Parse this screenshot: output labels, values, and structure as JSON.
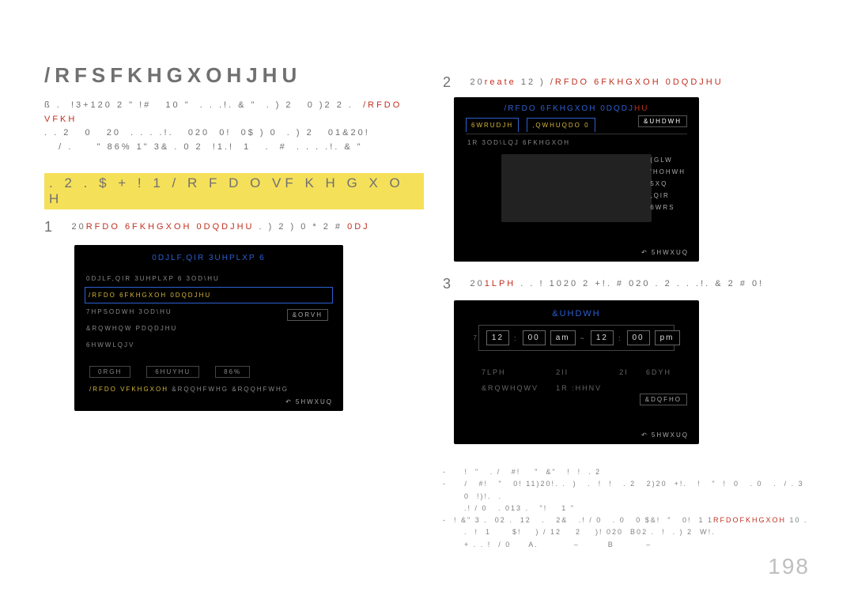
{
  "page_number": "198",
  "title": "/RFSFKHGXOHJHU",
  "intro_lines": [
    {
      "spans": [
        {
          "t": "ß .  !3+120 2 \" !#   10 \"  . . .!. & \"  . ) 2   0 )2 2 .  "
        },
        {
          "t": "/RFDO VFKH",
          "cls": "red"
        }
      ]
    },
    {
      "spans": [
        {
          "t": ". . 2   0   20  . . . .!.   020  0!  0$ ) 0  . ) 2   01&20!"
        }
      ]
    },
    {
      "spans": [
        {
          "t": "   / .     \" 86% 1\" 3& . 0 2  !1.!  1   .  #  . . . .!. & \""
        }
      ]
    }
  ],
  "highlight": ". 2 . $ + !  1  / R F D O  VF K H G X O H",
  "step1": {
    "num": "1",
    "spans": [
      {
        "t": "  20"
      },
      {
        "t": "RFDO 6FKHGXOH 0DQDJHU",
        "cls": "red"
      },
      {
        "t": " . ) 2    )    0 * 2 # "
      },
      {
        "t": "0DJ",
        "cls": "red"
      }
    ]
  },
  "screen1": {
    "title": "0DJLF,QIR 3UHPLXP 6",
    "items": [
      "0DJLF,QIR 3UHPLXP 6 3OD\\HU",
      "/RFDO 6FKHGXOH 0DQDJHU",
      "7HPSODWH 3OD\\HU",
      "&RQWHQW PDQDJHU",
      "6HWWLQJV"
    ],
    "selected_index": 1,
    "close": "&ORVH",
    "bottom": [
      "0RGH",
      "6HUYHU",
      "86%"
    ],
    "status_parts": [
      {
        "t": "/RFDO VFKHGXOH",
        "cls": "gold"
      },
      {
        "t": "&RQQHFWHG &RQQHFWHG"
      }
    ],
    "return": "5HWXUQ"
  },
  "step2": {
    "num": "2",
    "spans": [
      {
        "t": " 20"
      },
      {
        "t": "reate",
        "cls": "red"
      },
      {
        "t": "  12     )   "
      },
      {
        "t": "/RFDO 6FKHGXOH 0DQDJHU",
        "cls": "red"
      }
    ]
  },
  "screen2": {
    "title": "/RFDO 6FKHGXOH 0DQDJ",
    "title_suffix": "HU",
    "tabs": [
      "6WRUDJH",
      ",QWHUQDO 0"
    ],
    "tab_over": "&UHDWH",
    "playlist_line": "1R 3OD\\LQJ 6FKHGXOH",
    "side": [
      "(GLW",
      "'HOHWH",
      "5XQ",
      ",QIR",
      "6WRS"
    ],
    "return": "5HWXUQ"
  },
  "step3": {
    "num": "3",
    "spans": [
      {
        "t": " 20"
      },
      {
        "t": "1LPH",
        "cls": "red"
      },
      {
        "t": " .   .  !  1020  2   +!.   #   020   . 2   . . .!. &   2 #  0!"
      }
    ]
  },
  "screen3": {
    "title": "&UHDWH",
    "time": {
      "h1": "12",
      "m1": "00",
      "ap1": "am",
      "dash": "~",
      "h2": "12",
      "m2": "00",
      "ap2": "pm"
    },
    "grid": {
      "r1c1": "7LPH",
      "r1c2": "2II",
      "r1c3": "2I",
      "r1c4": "6DYH",
      "r2c1": "&RQWHQWV",
      "r2c2": "1R :HHNV"
    },
    "cancel": "&DQFHO",
    "return": "5HWXUQ"
  },
  "notes": [
    [
      {
        "t": "-     !  \"   . /   #!    \"  &\"   !  !  . 2"
      }
    ],
    [
      {
        "t": "-     /   #!   \"   0! 11)20!. .  )   .  !  !   . 2   2)20  "
      },
      {
        "t": "+!.   !   \"  !  0   . 0   .  / . 3"
      }
    ],
    [
      {
        "t": "      0  !)!.  ."
      }
    ],
    [
      {
        "t": "      .! / 0   . 013 .   \"!    1 \""
      }
    ],
    [
      {
        "t": "-  ! &\" 3 .  02 .  12   .   2&   .! / 0   . 0   0 $&!  \"   0!  1 1"
      },
      {
        "t": "RFDOFKHGXOH",
        "cls": "red"
      },
      {
        "t": " 10 .  "
      }
    ],
    [
      {
        "t": "      .  !  1      $!    ) / 12    2    )! 020  B02 .  !  . ) 2  W!. "
      }
    ],
    [
      {
        "t": "      + . . !  / 0     A.          –        B         –"
      }
    ]
  ]
}
